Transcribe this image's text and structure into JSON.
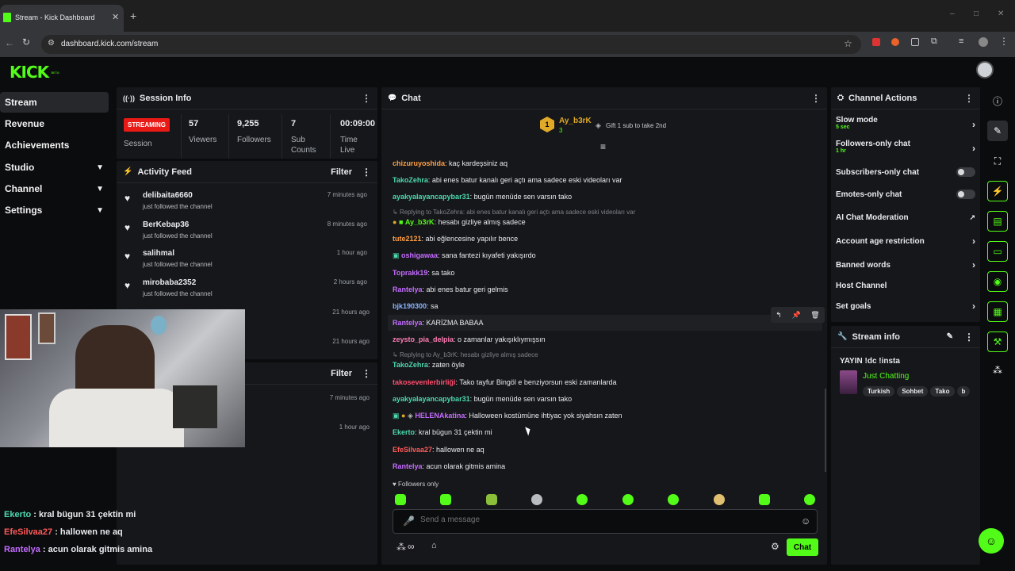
{
  "browser": {
    "tab_title": "Stream - Kick Dashboard",
    "new_tab": "+",
    "url": "dashboard.kick.com/stream",
    "window_controls": [
      "–",
      "□",
      "✕"
    ]
  },
  "brand": {
    "logo": "KICK",
    "beta": "BETA",
    "accent": "#53fc18"
  },
  "nav": {
    "items": [
      {
        "label": "Stream",
        "active": true
      },
      {
        "label": "Revenue"
      },
      {
        "label": "Achievements"
      },
      {
        "label": "Studio",
        "expand": true
      },
      {
        "label": "Channel",
        "expand": true
      },
      {
        "label": "Settings",
        "expand": true
      }
    ]
  },
  "session": {
    "title": "Session Info",
    "badge": "STREAMING",
    "badge_label": "Session",
    "stats": [
      {
        "value": "57",
        "label": "Viewers"
      },
      {
        "value": "9,255",
        "label": "Followers"
      },
      {
        "value": "7",
        "label": "Sub Counts"
      },
      {
        "value": "00:09:00",
        "label": "Time Live"
      }
    ]
  },
  "activity": {
    "title": "Activity Feed",
    "filter": "Filter",
    "items": [
      {
        "name": "delibaita6660",
        "sub": "just followed the channel",
        "time": "7 minutes ago"
      },
      {
        "name": "BerKebap36",
        "sub": "just followed the channel",
        "time": "8 minutes ago"
      },
      {
        "name": "salihmal",
        "sub": "just followed the channel",
        "time": "1 hour ago"
      },
      {
        "name": "mirobaba2352",
        "sub": "just followed the channel",
        "time": "2 hours ago"
      }
    ],
    "extra_times": [
      "21 hours ago",
      "21 hours ago"
    ],
    "second_filter": "Filter",
    "second_times": [
      "7 minutes ago",
      "1 hour ago"
    ]
  },
  "overlay_chat": [
    {
      "user": "Ekerto",
      "text": " : kral bügun 31 çektin mi",
      "color": "#4dd9b0"
    },
    {
      "user": "EfeSilvaa27",
      "text": " : hallowen ne aq",
      "color": "#ff5a5a"
    },
    {
      "user": "Rantelya",
      "text": " : acun olarak gitmis amina",
      "color": "#c46cff"
    }
  ],
  "chat": {
    "title": "Chat",
    "pinned_user": "Ay_b3rK",
    "pinned_badge": "1",
    "pinned_count": "3",
    "gift_text": "Gift 1 sub to take 2nd",
    "messages": [
      {
        "user": "chizuruyoshida",
        "text": ": kaç kardeşsiniz aq",
        "color": "#ff9f45"
      },
      {
        "user": "TakoZehra",
        "text": ": abi enes batur kanalı geri açtı ama sadece eski videoları var",
        "color": "#4dd9b0"
      },
      {
        "user": "ayakyalayancapybar31",
        "text": ": bugün menüde sen varsın tako",
        "color": "#4dd9b0"
      },
      {
        "user": "Ay_b3rK",
        "text": ": hesabı gizliye almış sadece",
        "color": "#53fc18",
        "reply": "Replying to TakoZehra: abi enes batur kanalı geri açtı ama sadece eski videoları var"
      },
      {
        "user": "tute2121",
        "text": ": abi eğlencesine yapılır bence",
        "color": "#ff9f45"
      },
      {
        "user": "oshigawaa",
        "text": ": sana fantezi kıyafeti yakışırdo",
        "color": "#c46cff"
      },
      {
        "user": "Toprakk19",
        "text": ": sa tako",
        "color": "#c46cff"
      },
      {
        "user": "Rantelya",
        "text": ": abi enes batur geri gelmis",
        "color": "#c46cff"
      },
      {
        "user": "bjk190300",
        "text": ": sa",
        "color": "#8ab4ff"
      },
      {
        "user": "Rantelya",
        "text": ": KARİZMA BABAA",
        "color": "#c46cff"
      },
      {
        "user": "zeysto_pia_delpia",
        "text": ": o zamanlar yakışıklıymışsın",
        "color": "#ff7eb6"
      },
      {
        "user": "TakoZehra",
        "text": ": zaten öyle",
        "color": "#4dd9b0",
        "reply": "Replying to Ay_b3rK: hesabı gizliye almış sadece"
      },
      {
        "user": "takosevenlerbirliği",
        "text": ": Tako tayfur Bingöl e benziyorsun eski zamanlarda",
        "color": "#ff4d6d"
      },
      {
        "user": "ayakyalayancapybar31",
        "text": ": bugün menüde sen varsın tako",
        "color": "#4dd9b0"
      },
      {
        "user": "HELENAkatina",
        "text": ": Halloween kostümüne ihtiyac yok siyahsın zaten",
        "color": "#c46cff"
      },
      {
        "user": "Ekerto",
        "text": ": kral bügun 31 çektin mi",
        "color": "#4dd9b0"
      },
      {
        "user": "EfeSilvaa27",
        "text": ": hallowen ne aq",
        "color": "#ff5a5a"
      },
      {
        "user": "Rantelya",
        "text": ": acun olarak gitmis amina",
        "color": "#c46cff"
      }
    ],
    "followers_only": "Followers only",
    "input_placeholder": "Send a message",
    "send_label": "Chat"
  },
  "channel_actions": {
    "title": "Channel Actions",
    "rows": [
      {
        "label": "Slow mode",
        "sub": "5 sec",
        "kind": "arrow"
      },
      {
        "label": "Followers-only chat",
        "sub": "1 hr",
        "kind": "arrow"
      },
      {
        "label": "Subscribers-only chat",
        "kind": "toggle"
      },
      {
        "label": "Emotes-only chat",
        "kind": "toggle"
      },
      {
        "label": "AI Chat Moderation",
        "kind": "ext"
      },
      {
        "label": "Account age restriction",
        "kind": "arrow"
      },
      {
        "label": "Banned words",
        "kind": "arrow"
      },
      {
        "label": "Host Channel",
        "kind": "none"
      },
      {
        "label": "Set goals",
        "kind": "arrow"
      }
    ]
  },
  "stream_info": {
    "title": "Stream info",
    "stream_title": "YAYIN !dc !insta",
    "category": "Just Chatting",
    "tags": [
      "Turkish",
      "Sohbet",
      "Tako",
      "b"
    ]
  }
}
